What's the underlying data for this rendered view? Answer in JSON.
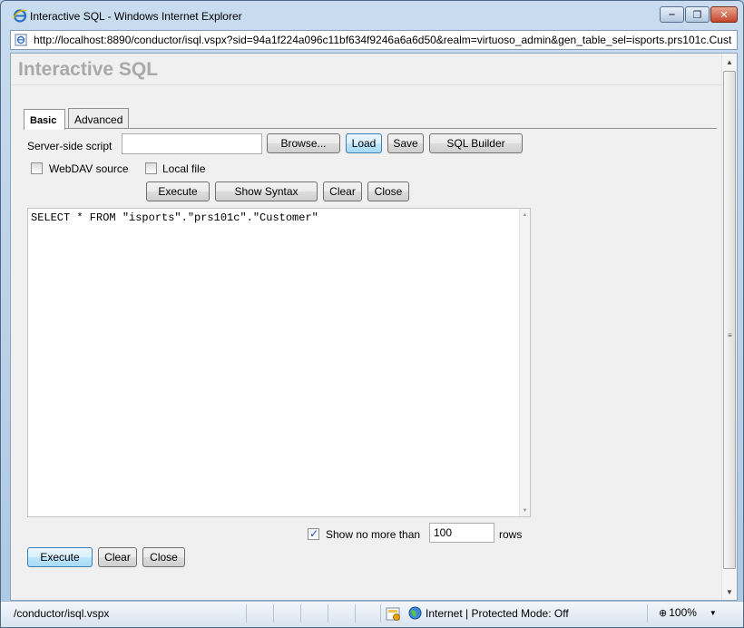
{
  "window": {
    "title": "Interactive SQL - Windows Internet Explorer",
    "minimize_glyph": "‒",
    "maximize_glyph": "❐",
    "close_glyph": "✕"
  },
  "address": {
    "url": "http://localhost:8890/conductor/isql.vspx?sid=94a1f224a096c11bf634f9246a6a6d50&realm=virtuoso_admin&gen_table_sel=isports.prs101c.Cust"
  },
  "page": {
    "title": "Interactive SQL",
    "tabs": [
      {
        "label": "Basic",
        "active": true
      },
      {
        "label": "Advanced",
        "active": false
      }
    ],
    "server_script_label": "Server-side script",
    "server_script_value": "",
    "browse_label": "Browse...",
    "load_label": "Load",
    "save_label": "Save",
    "sql_builder_label": "SQL Builder",
    "webdav_label": "WebDAV source",
    "webdav_checked": false,
    "localfile_label": "Local file",
    "localfile_checked": false,
    "top_buttons": {
      "execute": "Execute",
      "show_syntax": "Show Syntax",
      "clear": "Clear",
      "close": "Close"
    },
    "sql_text": "SELECT * FROM \"isports\".\"prs101c\".\"Customer\"",
    "limit_checked": true,
    "limit_label": "Show no more than",
    "limit_value": "100",
    "limit_suffix": "rows",
    "bottom_buttons": {
      "execute": "Execute",
      "clear": "Clear",
      "close": "Close"
    }
  },
  "status": {
    "path": "/conductor/isql.vspx",
    "zone": "Internet | Protected Mode: Off",
    "zoom": "100%"
  },
  "colors": {
    "frame": "#b9d1ea",
    "title_gray": "#a9a9a9",
    "check_blue": "#2a4fa8"
  }
}
